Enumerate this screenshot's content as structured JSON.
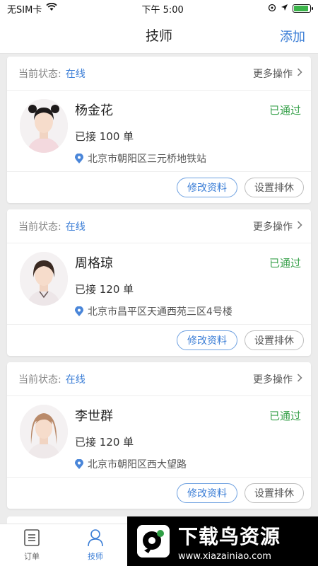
{
  "status_bar": {
    "carrier": "无SIM卡",
    "time": "下午 5:00",
    "battery_level": 0.9
  },
  "header": {
    "title": "技师",
    "add_label": "添加"
  },
  "labels": {
    "current_status": "当前状态:",
    "more_actions": "更多操作",
    "edit_profile": "修改资料",
    "set_rest": "设置排休"
  },
  "technicians": [
    {
      "status": "在线",
      "name": "杨金花",
      "review": "已通过",
      "orders": "已接 100 单",
      "address": "北京市朝阳区三元桥地铁站"
    },
    {
      "status": "在线",
      "name": "周格琼",
      "review": "已通过",
      "orders": "已接 120 单",
      "address": "北京市昌平区天通西苑三区4号楼"
    },
    {
      "status": "在线",
      "name": "李世群",
      "review": "已通过",
      "orders": "已接 120 单",
      "address": "北京市朝阳区西大望路"
    }
  ],
  "tabs": [
    {
      "label": "订单",
      "icon": "document-list-icon",
      "active": false
    },
    {
      "label": "技师",
      "icon": "person-icon",
      "active": true
    }
  ],
  "watermark": {
    "main": "下载鸟资源",
    "sub": "www.xiazainiao.com"
  },
  "colors": {
    "accent": "#3a7dd6",
    "approved": "#3aa24d"
  }
}
